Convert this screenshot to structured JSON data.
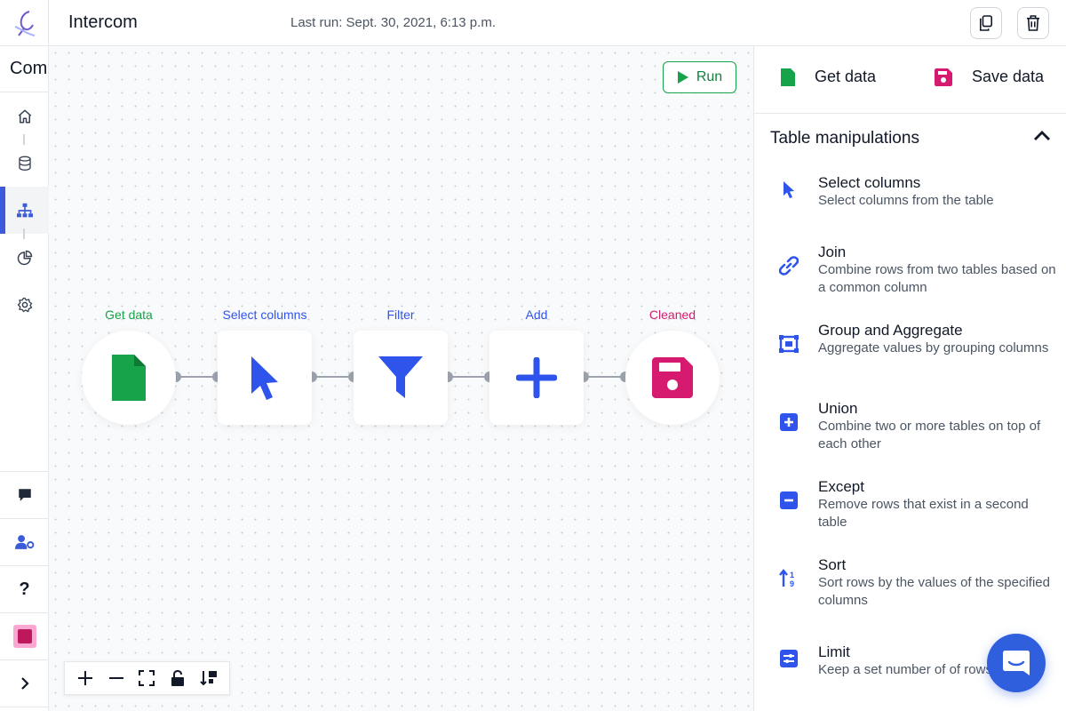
{
  "header": {
    "title": "Intercom",
    "last_run": "Last run: Sept. 30, 2021, 6:13 p.m."
  },
  "rail": {
    "project_name": "Com",
    "nav": [
      "home-icon",
      "database-icon",
      "pipeline-icon",
      "chart-pie-icon",
      "settings-icon"
    ],
    "active": "pipeline-icon",
    "bottom": [
      "chat-icon",
      "user-settings-icon",
      "help-icon",
      "avatar",
      "expand-icon"
    ]
  },
  "canvas": {
    "run_label": "Run",
    "nodes": [
      {
        "label": "Get data",
        "color": "#16a34a",
        "icon": "file-icon"
      },
      {
        "label": "Select columns",
        "color": "#2f54eb",
        "icon": "cursor-icon"
      },
      {
        "label": "Filter",
        "color": "#2f54eb",
        "icon": "filter-icon"
      },
      {
        "label": "Add",
        "color": "#2f54eb",
        "icon": "plus-icon"
      },
      {
        "label": "Cleaned",
        "color": "#d61a6f",
        "icon": "save-icon"
      }
    ],
    "zoom_controls": [
      "zoom-in-icon",
      "zoom-out-icon",
      "fit-view-icon",
      "lock-icon",
      "sort-icon"
    ]
  },
  "panel": {
    "get_data": "Get data",
    "save_data": "Save data",
    "section_title": "Table manipulations",
    "operations": [
      {
        "title": "Select columns",
        "desc": "Select columns from the table",
        "icon": "cursor-icon"
      },
      {
        "title": "Join",
        "desc": "Combine rows from two tables based on a common column",
        "icon": "link-icon"
      },
      {
        "title": "Group and Aggregate",
        "desc": "Aggregate values by grouping columns",
        "icon": "group-icon"
      },
      {
        "title": "Union",
        "desc": "Combine two or more tables on top of each other",
        "icon": "plus-square-icon"
      },
      {
        "title": "Except",
        "desc": "Remove rows that exist in a second table",
        "icon": "minus-square-icon"
      },
      {
        "title": "Sort",
        "desc": "Sort rows by the values of the specified columns",
        "icon": "sort-icon"
      },
      {
        "title": "Limit",
        "desc": "Keep a set number of of rows",
        "icon": "sliders-icon"
      }
    ]
  },
  "colors": {
    "accent": "#2f54eb",
    "green": "#16a34a",
    "pink": "#d61a6f",
    "intercom_blue": "#2f5fdc"
  }
}
